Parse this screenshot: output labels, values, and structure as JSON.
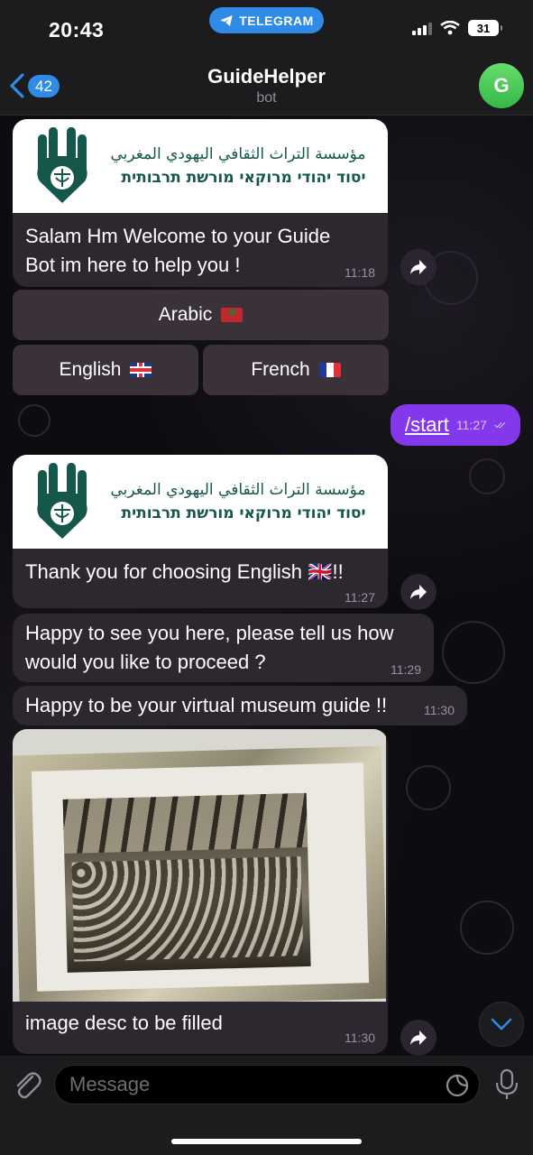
{
  "status_bar": {
    "time": "20:43",
    "return_app": "TELEGRAM",
    "battery": "31"
  },
  "header": {
    "unread_count": "42",
    "title": "GuideHelper",
    "subtitle": "bot",
    "avatar_letter": "G"
  },
  "logo": {
    "arabic": "مؤسسة التراث الثقافي اليهودي المغربي",
    "hebrew": "יסוד יהודי מרוקאי מורשת תרבותית"
  },
  "messages": {
    "welcome": {
      "text": "Salam Hm Welcome to your Guide Bot im here to help you !",
      "time": "11:18"
    },
    "start": {
      "text": "/start",
      "time": "11:27"
    },
    "thanks": {
      "text": "Thank you for choosing English 🇬🇧!!",
      "time": "11:27"
    },
    "proceed": {
      "text": "Happy to see you here, please tell us how would you like to proceed ?",
      "time": "11:29"
    },
    "guide": {
      "text": "Happy to be your virtual museum guide !!",
      "time": "11:30"
    },
    "image": {
      "text": "image desc to be filled",
      "time": "11:30"
    }
  },
  "keyboard": {
    "arabic": "Arabic",
    "english": "English",
    "french": "French"
  },
  "input": {
    "placeholder": "Message"
  },
  "colors": {
    "accent": "#2f8be5",
    "outgoing": "#8338ec",
    "incoming": "#2d2830",
    "logo_green": "#16574b"
  }
}
